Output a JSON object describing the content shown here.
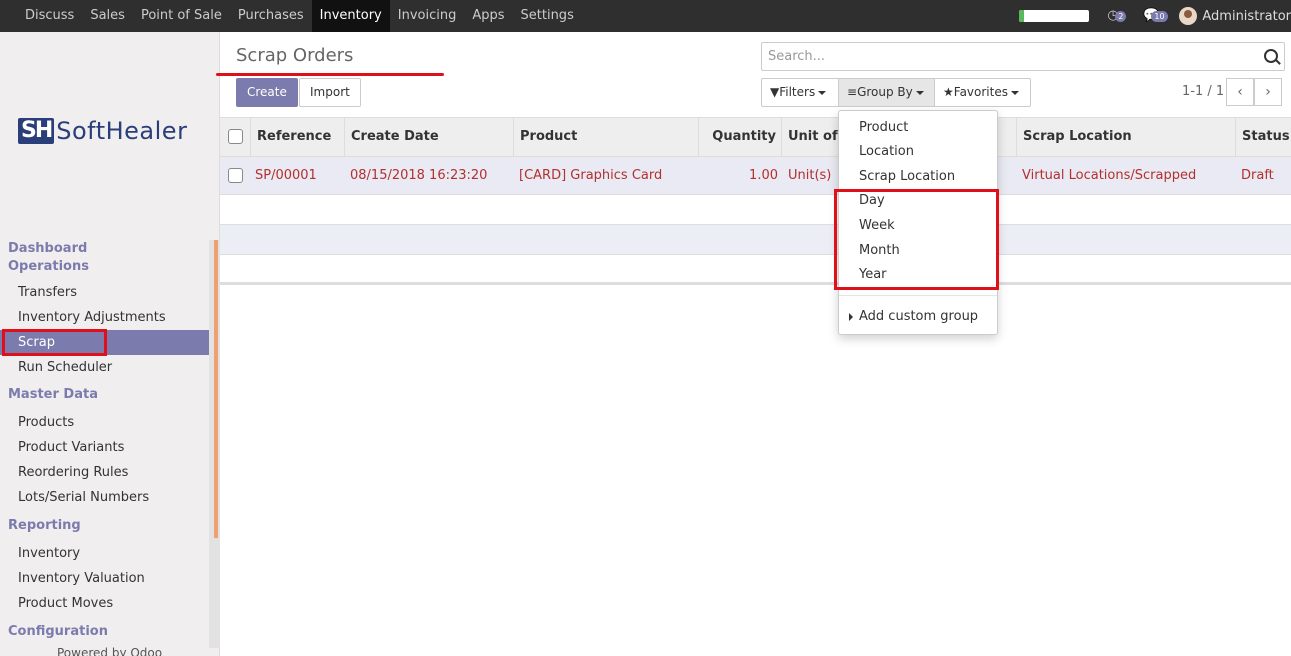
{
  "topbar": {
    "menu": [
      "Discuss",
      "Sales",
      "Point of Sale",
      "Purchases",
      "Inventory",
      "Invoicing",
      "Apps",
      "Settings"
    ],
    "active": "Inventory",
    "progress": 0.07,
    "activities_count": "2",
    "messages_count": "10",
    "user": "Administrator"
  },
  "sidebar": {
    "logo_mark": "SH",
    "logo_text": "SoftHealer",
    "sections": [
      {
        "header": "Dashboard",
        "items": []
      },
      {
        "header": "Operations",
        "items": [
          "Transfers",
          "Inventory Adjustments",
          "Scrap",
          "Run Scheduler"
        ]
      },
      {
        "header": "Master Data",
        "items": [
          "Products",
          "Product Variants",
          "Reordering Rules",
          "Lots/Serial Numbers"
        ]
      },
      {
        "header": "Reporting",
        "items": [
          "Inventory",
          "Inventory Valuation",
          "Product Moves"
        ]
      },
      {
        "header": "Configuration",
        "items": []
      }
    ],
    "active_item": "Scrap",
    "footer": "Powered by Odoo"
  },
  "control": {
    "title": "Scrap Orders",
    "create_label": "Create",
    "import_label": "Import",
    "search_placeholder": "Search...",
    "filters_label": "Filters",
    "groupby_label": "Group By",
    "favorites_label": "Favorites",
    "pager": "1-1 / 1"
  },
  "table": {
    "columns": [
      "Reference",
      "Create Date",
      "Product",
      "Quantity",
      "Unit of M",
      "Scrap Location",
      "Status"
    ],
    "rows": [
      [
        "SP/00001",
        "08/15/2018 16:23:20",
        "[CARD] Graphics Card",
        "1.00",
        "Unit(s)",
        "Virtual Locations/Scrapped",
        "Draft"
      ]
    ]
  },
  "groupby_menu": {
    "items": [
      "Product",
      "Location",
      "Scrap Location"
    ],
    "date_items": [
      "Day",
      "Week",
      "Month",
      "Year"
    ],
    "custom": "Add custom group"
  }
}
